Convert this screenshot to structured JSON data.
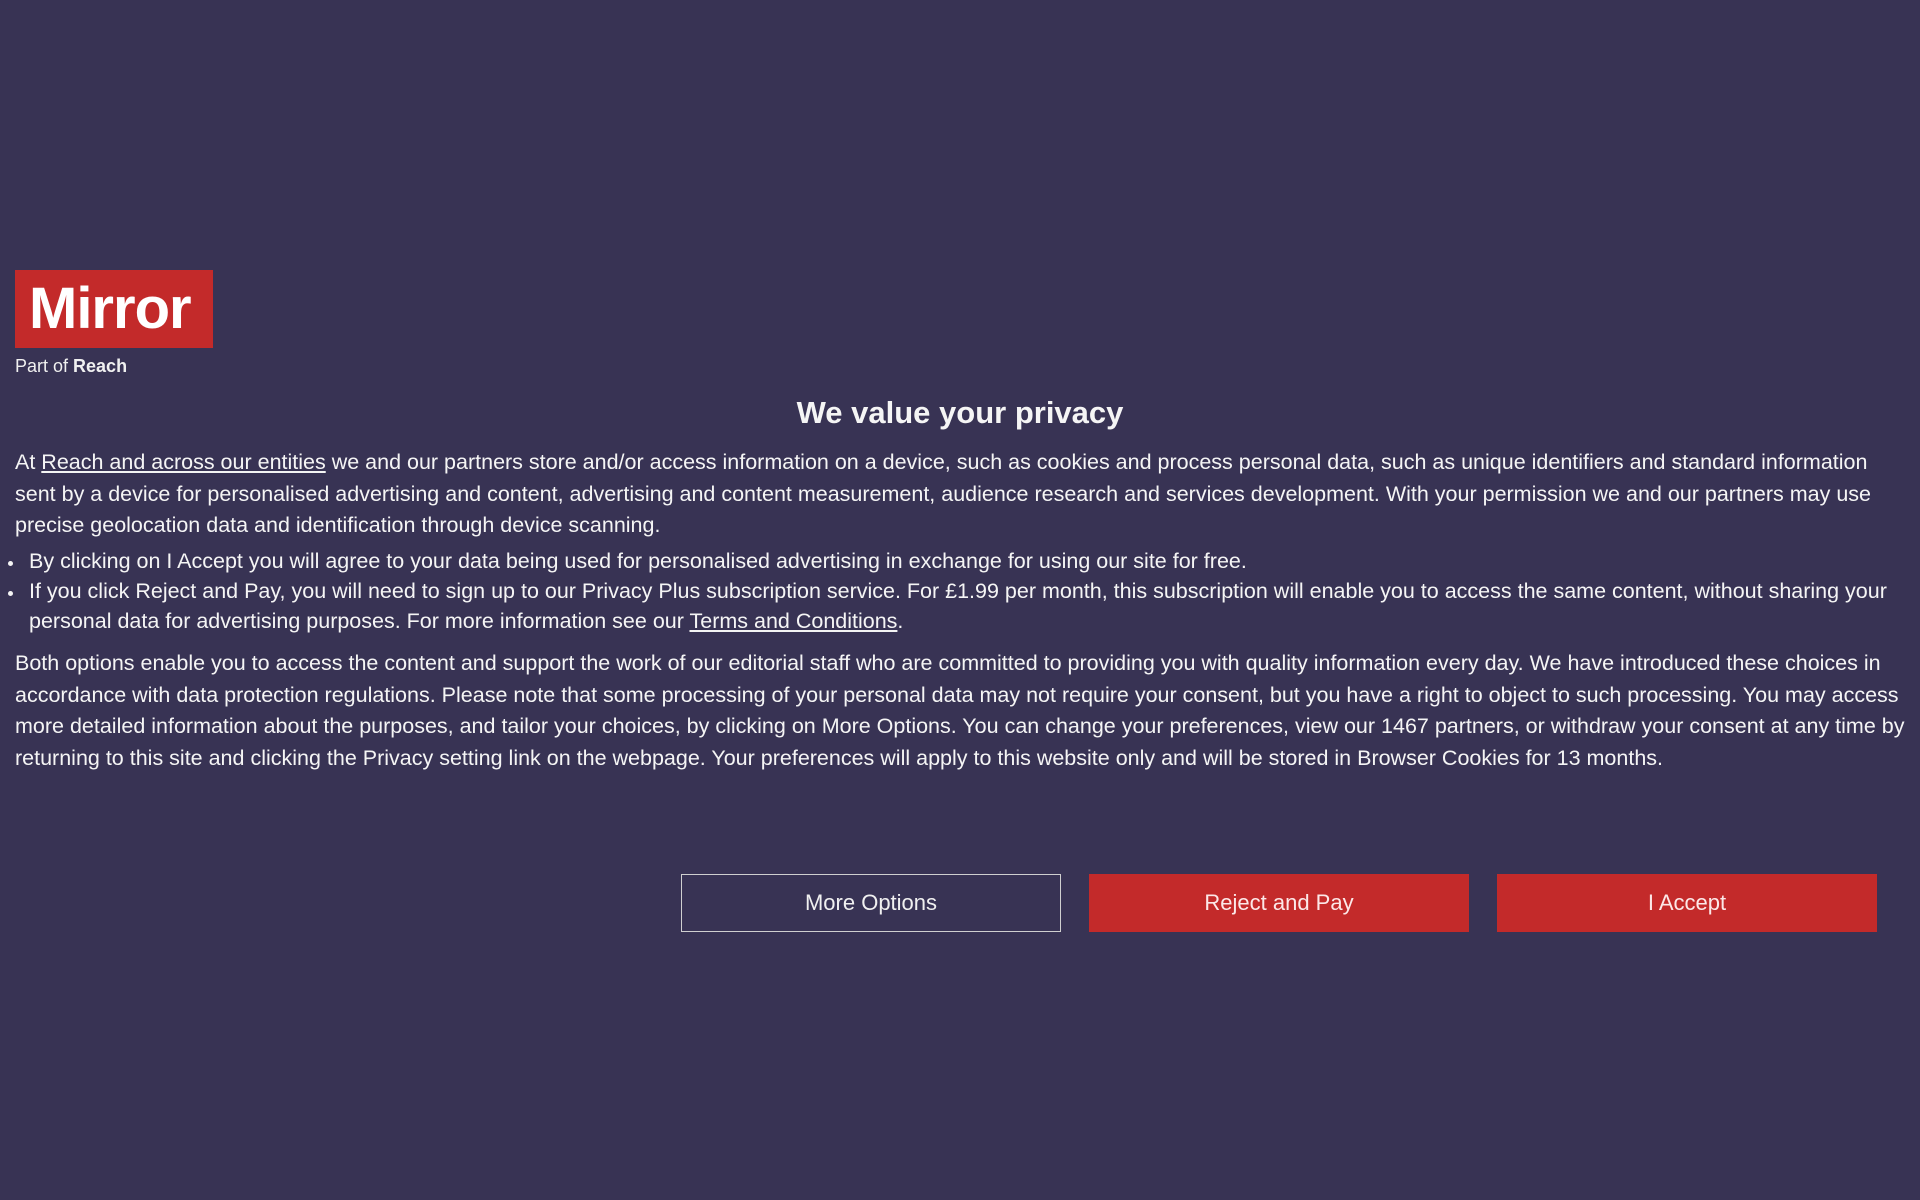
{
  "logo": {
    "brand": "Mirror",
    "sub_prefix": "Part of ",
    "sub_bold": "Reach"
  },
  "heading": "We value your privacy",
  "p1": {
    "prefix": "At ",
    "link": "Reach and across our entities",
    "rest": " we and our partners store and/or access information on a device, such as cookies and process personal data, such as unique identifiers and standard information sent by a device for personalised advertising and content, advertising and content measurement, audience research and services development. With your permission we and our partners may use precise geolocation data and identification through device scanning."
  },
  "bullets": {
    "b1": "By clicking on I Accept you will agree to your data being used for personalised advertising in exchange for using our site for free.",
    "b2_pre": "If you click Reject and Pay, you will need to sign up to our Privacy Plus subscription service. For £1.99 per month, this subscription will enable you to access the same content, without sharing your personal data for advertising purposes. For more information see our ",
    "b2_link": "Terms and Conditions",
    "b2_post": "."
  },
  "p2": "Both options enable you to access the content and support the work of our editorial staff who are committed to providing you with quality information every day. We have introduced these choices in accordance with data protection regulations. Please note that some processing of your personal data may not require your consent, but you have a right to object to such processing. You may access more detailed information about the purposes, and tailor your choices, by clicking on More Options. You can change your preferences, view our 1467 partners, or withdraw your consent at any time by returning to this site and clicking the Privacy setting link on the webpage. Your preferences will apply to this website only and will be stored in Browser Cookies for 13 months.",
  "buttons": {
    "more": "More Options",
    "reject": "Reject and Pay",
    "accept": "I Accept"
  }
}
